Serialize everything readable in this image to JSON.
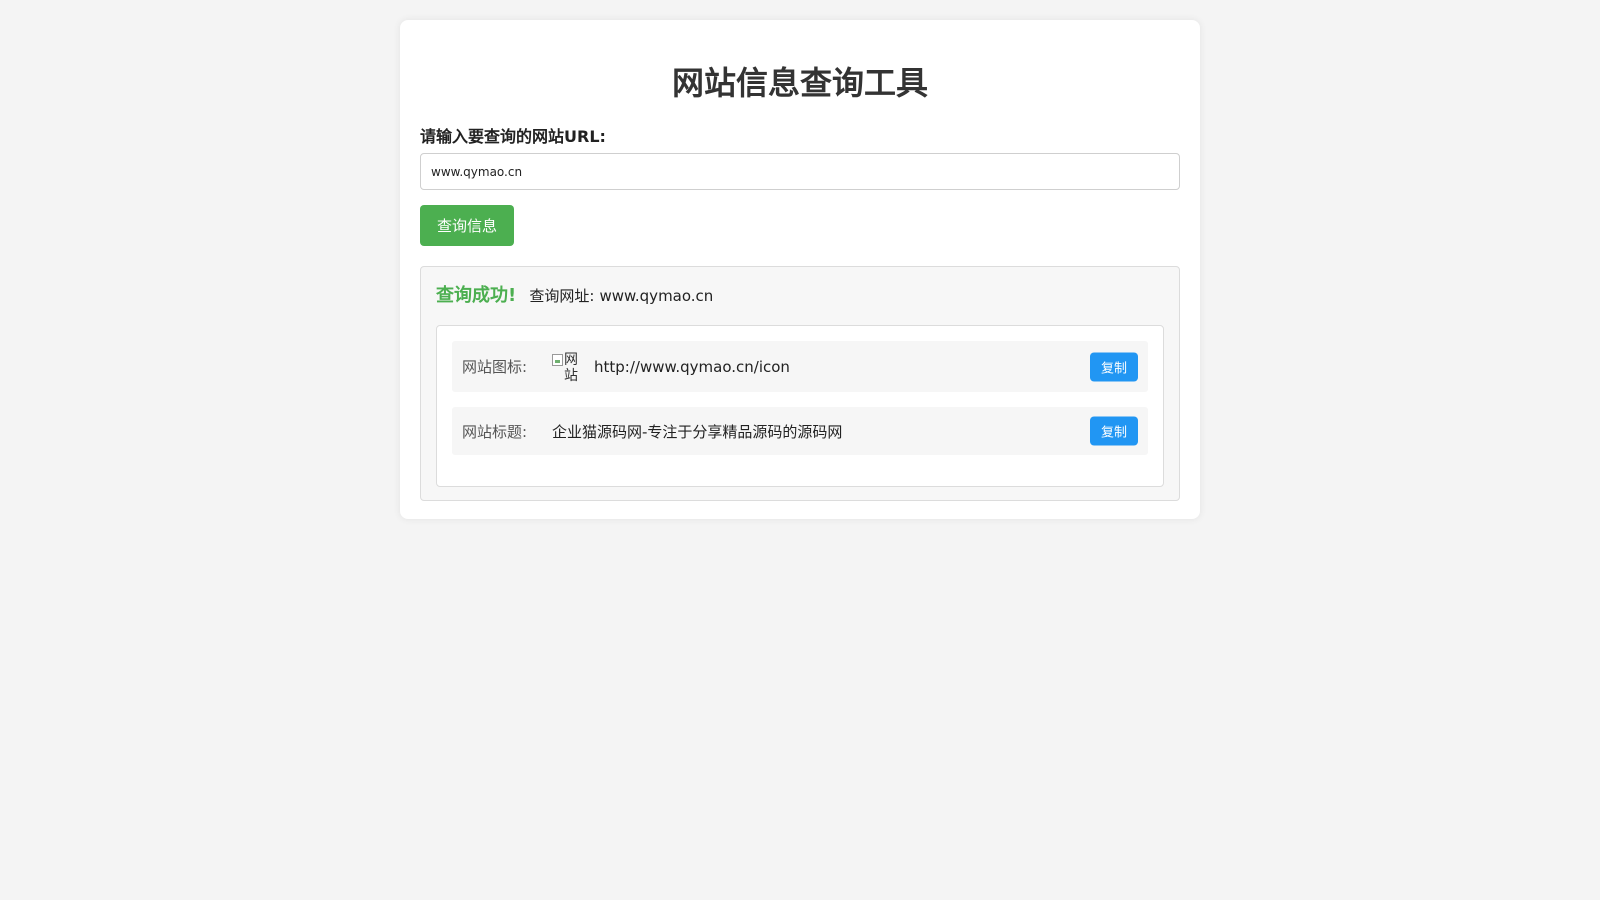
{
  "page": {
    "title": "网站信息查询工具"
  },
  "form": {
    "label": "请输入要查询的网站URL:",
    "input_value": "www.qymao.cn",
    "submit_label": "查询信息"
  },
  "result": {
    "status": "查询成功!",
    "query_label": "查询网址:",
    "query_url": "www.qymao.cn",
    "rows": [
      {
        "label": "网站图标:",
        "image_alt": "网站图标",
        "value": "http://www.qymao.cn/icon",
        "copy_label": "复制"
      },
      {
        "label": "网站标题:",
        "value": "企业猫源码网-专注于分享精品源码的源码网",
        "copy_label": "复制"
      }
    ]
  },
  "colors": {
    "primary_green": "#4caf50",
    "copy_blue": "#2196f3",
    "background": "#f4f4f4"
  }
}
